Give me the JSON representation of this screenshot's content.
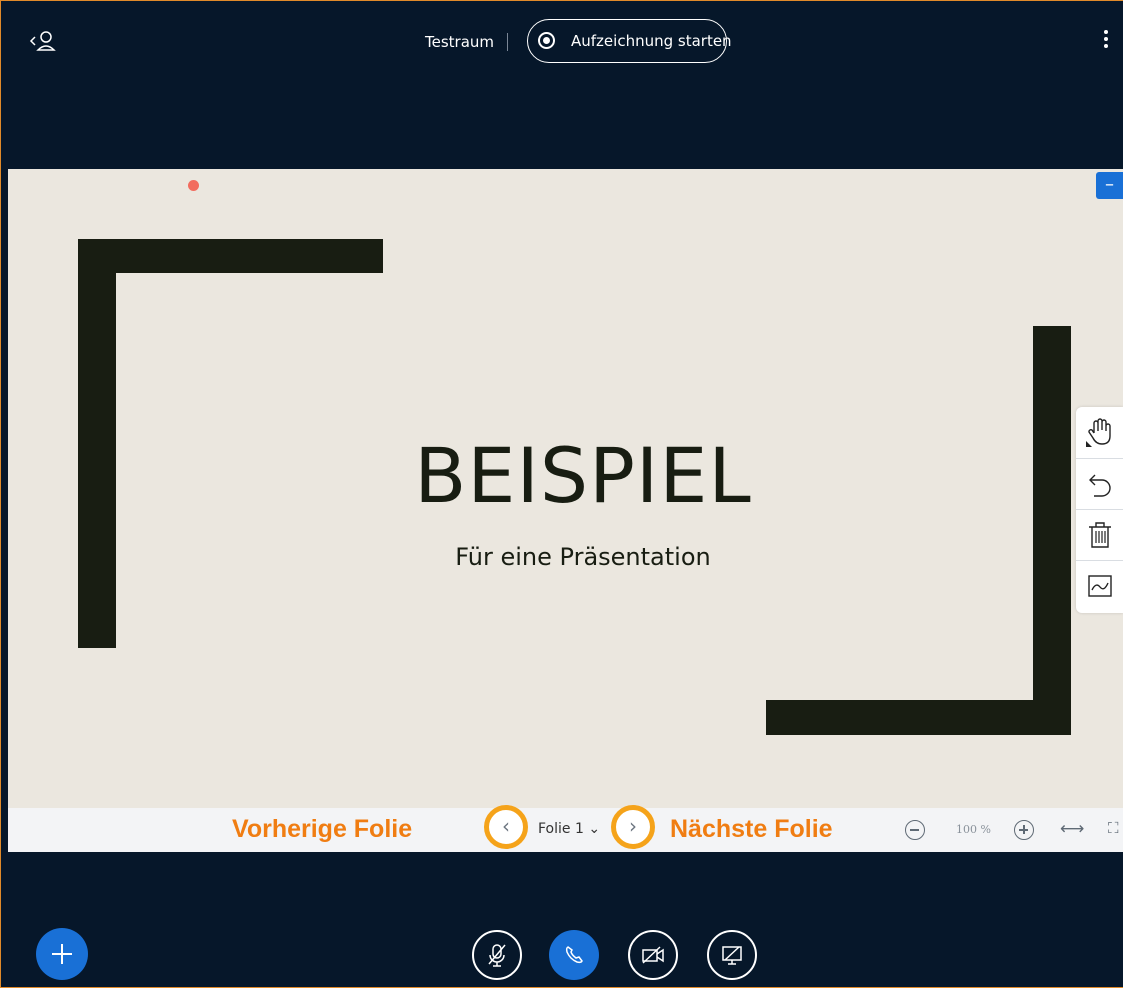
{
  "topbar": {
    "room_title": "Testraum",
    "record_label": "Aufzeichnung starten",
    "back_icon": "user-back-icon",
    "menu_icon": "kebab-menu-icon"
  },
  "slide": {
    "title": "BEISPIEL",
    "subtitle": "Für eine Präsentation",
    "collapse_label": "–"
  },
  "annotation_tools": [
    "hand-icon",
    "undo-icon",
    "trash-icon",
    "whiteboard-icon"
  ],
  "presentation_footer": {
    "annotation_prev": "Vorherige Folie",
    "annotation_next": "Nächste Folie",
    "prev_label": "‹",
    "next_label": "›",
    "slide_selector": "Folie 1 ⌄",
    "zoom_level": "100 %",
    "fit_width_label": "⟷",
    "fullscreen_label": "⛶"
  },
  "bottombar": {
    "actions_icon": "plus-icon",
    "controls": [
      "mic-muted-icon",
      "phone-icon",
      "camera-off-icon",
      "screenshare-off-icon"
    ]
  },
  "colors": {
    "background": "#06172a",
    "accent": "#1970d6",
    "annotation_orange": "#f07d12",
    "highlight_circle": "#f5a31a",
    "slide_bg": "#ebe7df",
    "slide_ink": "#181d12"
  }
}
